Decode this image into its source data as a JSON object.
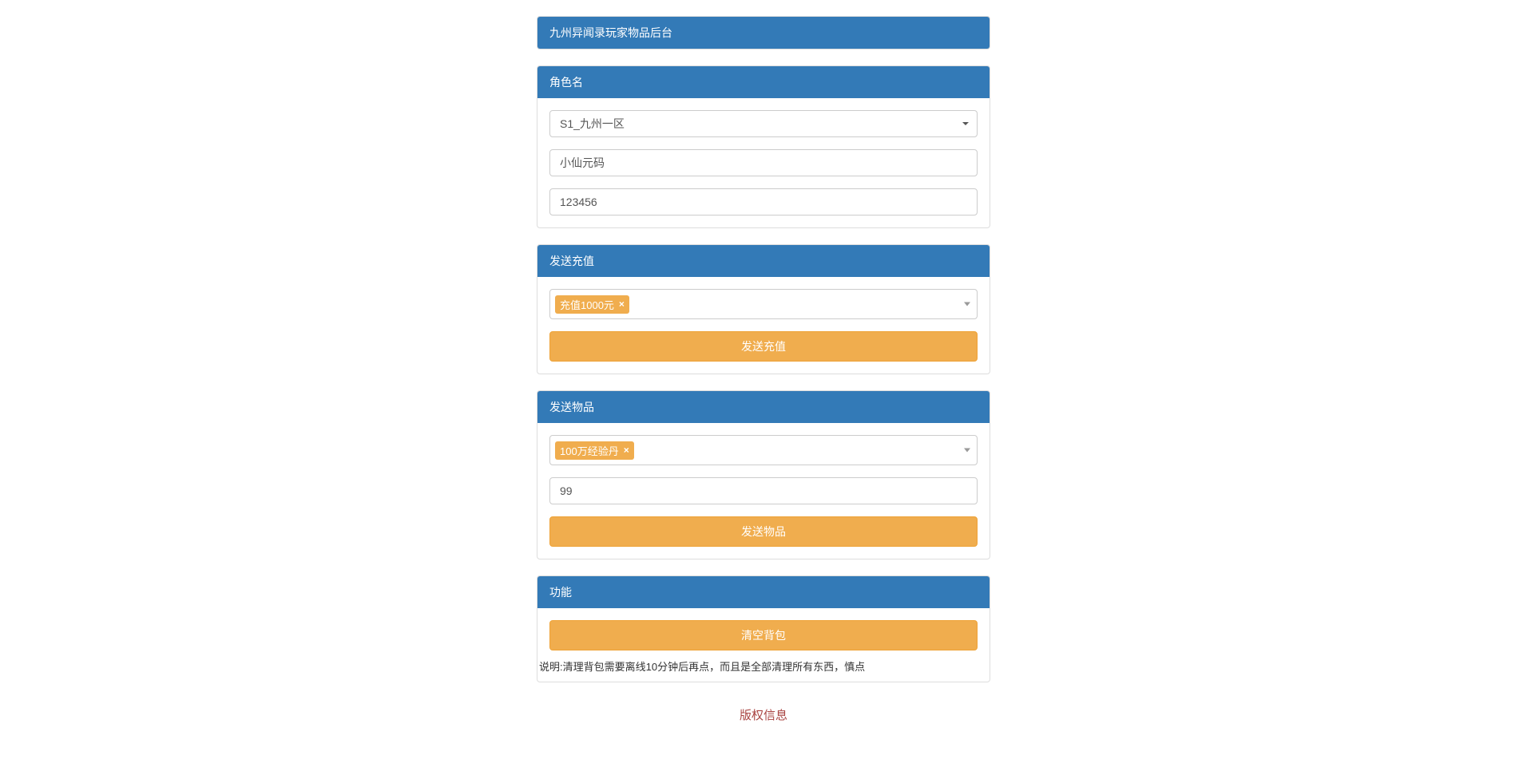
{
  "header": {
    "title": "九州异闻录玩家物品后台"
  },
  "panel_role": {
    "title": "角色名",
    "server_select": "S1_九州一区",
    "name_value": "小仙元码",
    "id_value": "123456"
  },
  "panel_recharge": {
    "title": "发送充值",
    "tag": "充值1000元",
    "button": "发送充值"
  },
  "panel_item": {
    "title": "发送物品",
    "tag": "100万经验丹",
    "quantity_value": "99",
    "button": "发送物品"
  },
  "panel_function": {
    "title": "功能",
    "button": "清空背包",
    "note": "说明:清理背包需要离线10分钟后再点，而且是全部清理所有东西，慎点"
  },
  "footer": {
    "text": "版权信息"
  }
}
